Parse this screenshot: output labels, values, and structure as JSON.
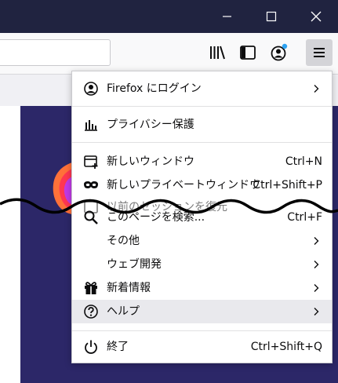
{
  "menu": {
    "items": [
      {
        "label": "Firefox にログイン",
        "shortcut": "",
        "icon": "account-icon"
      },
      {
        "label": "プライバシー保護",
        "shortcut": "",
        "icon": "privacy-dashboard-icon"
      },
      {
        "label": "新しいウィンドウ",
        "shortcut": "Ctrl+N",
        "icon": "new-window-icon"
      },
      {
        "label": "新しいプライベートウィンドウ",
        "shortcut": "Ctrl+Shift+P",
        "icon": "private-mask-icon"
      },
      {
        "label": "以前のセッションを復元",
        "shortcut": "",
        "icon": "restore-session-icon"
      },
      {
        "label": "このページを検索...",
        "shortcut": "Ctrl+F",
        "icon": "search-icon"
      },
      {
        "label": "その他",
        "shortcut": "",
        "icon": ""
      },
      {
        "label": "ウェブ開発",
        "shortcut": "",
        "icon": ""
      },
      {
        "label": "新着情報",
        "shortcut": "",
        "icon": "gift-icon"
      },
      {
        "label": "ヘルプ",
        "shortcut": "",
        "icon": "help-icon"
      },
      {
        "label": "終了",
        "shortcut": "Ctrl+Shift+Q",
        "icon": "power-icon"
      }
    ]
  },
  "colors": {
    "titlebar": "#202340",
    "content_bg": "#2c2768",
    "notification_dot": "#2ea3f2"
  }
}
